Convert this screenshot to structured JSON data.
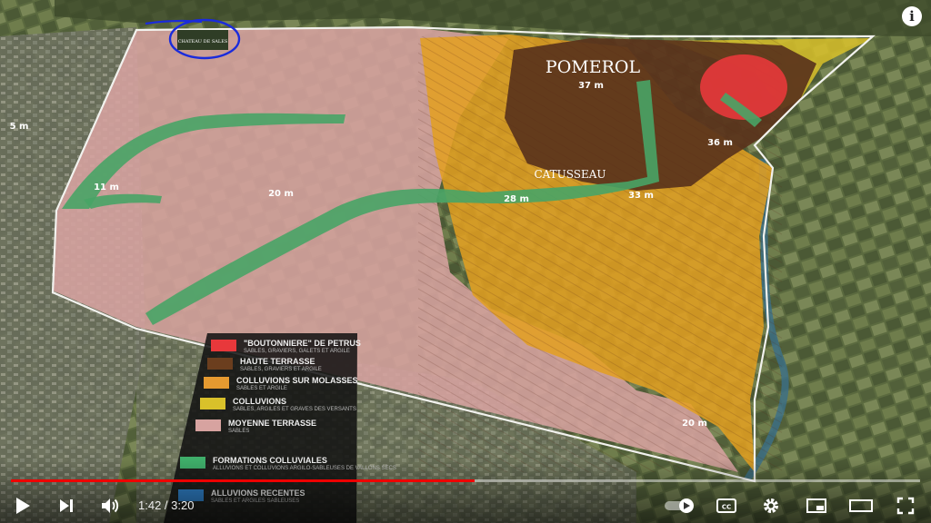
{
  "map": {
    "place_labels": {
      "pomerol": "POMEROL",
      "catusseau": "CATUSSEAU",
      "chateau": "CHATEAU DE SALES"
    },
    "elevations": {
      "e37": "37 m",
      "e36": "36 m",
      "e33": "33 m",
      "e28": "28 m",
      "e20a": "20 m",
      "e20b": "20 m",
      "e11": "11 m",
      "e5": "5 m"
    }
  },
  "legend": {
    "items": [
      {
        "title": "\"BOUTONNIERE\" DE PETRUS",
        "sub": "SABLES, GRAVIERS, GALETS ET ARGILE",
        "color": "#e8383b"
      },
      {
        "title": "HAUTE TERRASSE",
        "sub": "SABLES, GRAVIERS ET ARGILE",
        "color": "#6b3e1e"
      },
      {
        "title": "COLLUVIONS SUR MOLASSES",
        "sub": "SABLES ET ARGILE",
        "color": "#e59a30"
      },
      {
        "title": "COLLUVIONS",
        "sub": "SABLES, ARGILES ET GRAVES DES VERSANTS",
        "color": "#d9c12a"
      },
      {
        "title": "MOYENNE TERRASSE",
        "sub": "SABLES",
        "color": "#d7a3a0"
      },
      {
        "title": "FORMATIONS COLLUVIALES",
        "sub": "ALLUVIONS ET COLLUVIONS ARGILO-SABLEUSES DE VALLONS SECS",
        "color": "#3fae6a"
      },
      {
        "title": "ALLUVIONS RECENTES",
        "sub": "SABLES ET ARGILES SABLEUSES",
        "color": "#2f80c8"
      }
    ]
  },
  "player": {
    "time": "1:42 / 3:20",
    "progress": 0.51,
    "info": "i"
  },
  "colors": {
    "progress_red": "#ff0000",
    "annotation_blue": "#1a2bdc"
  }
}
